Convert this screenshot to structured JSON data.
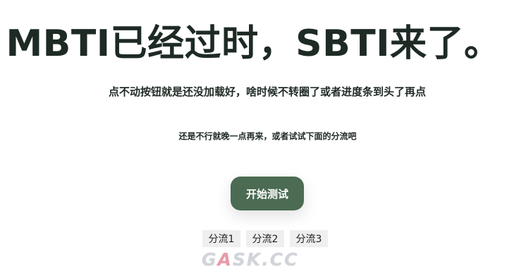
{
  "hero": {
    "title": "MBTI已经过时，SBTI来了。"
  },
  "subtitle": "点不动按钮就是还没加载好，啥时候不转圈了或者进度条到头了再点",
  "hint": "还是不行就晚一点再来，或者试试下面的分流吧",
  "start_button": {
    "label": "开始测试"
  },
  "split_links": [
    {
      "label": "分流1"
    },
    {
      "label": "分流2"
    },
    {
      "label": "分流3"
    }
  ],
  "watermark": {
    "part1": "G",
    "accent": "A",
    "part2": "SK.CC"
  },
  "colors": {
    "primary": "#4b6b52",
    "text": "#1f2a24",
    "link_bg": "#efefef",
    "watermark_accent": "#e58b98"
  }
}
